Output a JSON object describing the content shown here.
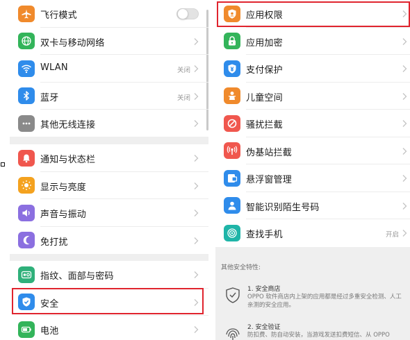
{
  "left": {
    "groups": [
      {
        "items": [
          {
            "label": "飞行模式",
            "icon": "airplane-icon",
            "color": "#F08A2C",
            "control": "toggle",
            "toggle_on": false
          },
          {
            "label": "双卡与移动网络",
            "icon": "globe-icon",
            "color": "#33B45A",
            "control": "chevron"
          },
          {
            "label": "WLAN",
            "icon": "wifi-icon",
            "color": "#2F8CEB",
            "value": "关闭",
            "control": "chevron"
          },
          {
            "label": "蓝牙",
            "icon": "bluetooth-icon",
            "color": "#2F8CEB",
            "value": "关闭",
            "control": "chevron"
          },
          {
            "label": "其他无线连接",
            "icon": "more-dots-icon",
            "color": "#8A8A8A",
            "control": "chevron"
          }
        ]
      },
      {
        "items": [
          {
            "label": "通知与状态栏",
            "icon": "bell-icon",
            "color": "#F0574E",
            "control": "chevron"
          },
          {
            "label": "显示与亮度",
            "icon": "sun-icon",
            "color": "#F4A21F",
            "control": "chevron"
          },
          {
            "label": "声音与振动",
            "icon": "speaker-icon",
            "color": "#8B6FE0",
            "control": "chevron"
          },
          {
            "label": "免打扰",
            "icon": "moon-icon",
            "color": "#8B6FE0",
            "control": "chevron"
          }
        ]
      },
      {
        "items": [
          {
            "label": "指纹、面部与密码",
            "icon": "fingerprint-icon",
            "color": "#2FB07A",
            "control": "chevron"
          },
          {
            "label": "安全",
            "icon": "shield-check-icon",
            "color": "#2F8CEB",
            "control": "chevron",
            "highlighted": true
          },
          {
            "label": "电池",
            "icon": "battery-icon",
            "color": "#33B45A",
            "control": "chevron"
          }
        ]
      }
    ]
  },
  "right": {
    "items": [
      {
        "label": "应用权限",
        "icon": "shield-app-icon",
        "color": "#F08A2C",
        "control": "chevron",
        "highlighted": true
      },
      {
        "label": "应用加密",
        "icon": "lock-icon",
        "color": "#33B45A",
        "control": "chevron"
      },
      {
        "label": "支付保护",
        "icon": "shield-pay-icon",
        "color": "#2F8CEB",
        "control": "chevron"
      },
      {
        "label": "儿童空间",
        "icon": "child-icon",
        "color": "#F08A2C",
        "control": "chevron"
      },
      {
        "label": "骚扰拦截",
        "icon": "block-icon",
        "color": "#F0574E",
        "control": "chevron"
      },
      {
        "label": "伪基站拦截",
        "icon": "signal-tower-icon",
        "color": "#F0574E",
        "control": "chevron"
      },
      {
        "label": "悬浮窗管理",
        "icon": "floating-window-icon",
        "color": "#2F8CEB",
        "control": "chevron"
      },
      {
        "label": "智能识别陌生号码",
        "icon": "contact-icon",
        "color": "#2F8CEB",
        "control": "chevron"
      },
      {
        "label": "查找手机",
        "icon": "find-phone-icon",
        "color": "#1FB5A8",
        "value": "开启",
        "control": "chevron"
      }
    ],
    "other_features": {
      "caption": "其他安全特性:",
      "items": [
        {
          "title": "1. 安全商店",
          "desc": "OPPO 软件商店内上架的应用都是经过多重安全检测、人工亲测的安全应用。",
          "icon": "shield-outline-icon"
        },
        {
          "title": "2. 安全验证",
          "desc": "防扣费、防自动安装，当游戏发送扣费短信、从 OPPO",
          "icon": "fingerprint-outline-icon"
        }
      ]
    }
  },
  "colors": {
    "highlight": "#E0242E",
    "panel_bg": "#EFEFEF",
    "secondary_text": "#9A9A9A"
  }
}
